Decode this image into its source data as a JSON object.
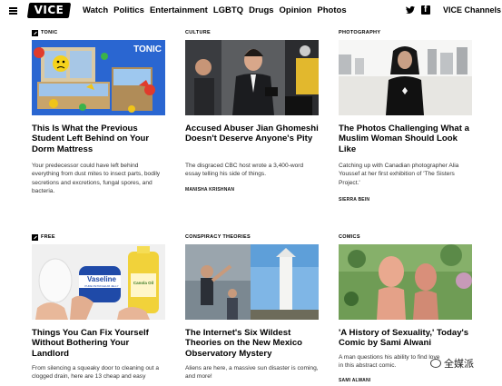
{
  "nav": {
    "logo": "VICE",
    "links": [
      "Watch",
      "Politics",
      "Entertainment",
      "LGBTQ",
      "Drugs",
      "Opinion",
      "Photos"
    ],
    "channels_label": "VICE Channels",
    "facebook_glyph": "f"
  },
  "cards": [
    {
      "category": "TONIC",
      "image_label": "TONIC",
      "headline": "This Is What the Previous Student Left Behind on Your Dorm Mattress",
      "dek": "Your predecessor could have left behind everything from dust mites to insect parts, bodily secretions and excretions, fungal spores, and bacteria.",
      "byline": ""
    },
    {
      "category": "CULTURE",
      "headline": "Accused Abuser Jian Ghomeshi Doesn't Deserve Anyone's Pity",
      "dek": "The disgraced CBC host wrote a 3,400-word essay telling his side of things.",
      "byline": "MANISHA KRISHNAN"
    },
    {
      "category": "PHOTOGRAPHY",
      "headline": "The Photos Challenging What a Muslim Woman Should Look Like",
      "dek": "Catching up with Canadian photographer Alia Youssef at her first exhibition of 'The Sisters Project.'",
      "byline": "SIERRA BEIN"
    },
    {
      "category": "FREE",
      "headline": "Things You Can Fix Yourself Without Bothering Your Landlord",
      "dek": "From silencing a squeaky door to cleaning out a clogged drain, here are 13 cheap and easy",
      "byline": ""
    },
    {
      "category": "CONSPIRACY THEORIES",
      "headline": "The Internet's Six Wildest Theories on the New Mexico Observatory Mystery",
      "dek": "Aliens are here, a massive sun disaster is coming, and more!",
      "byline": ""
    },
    {
      "category": "COMICS",
      "headline": "'A History of Sexuality,' Today's Comic by Sami Alwani",
      "dek": "A man questions his ability to find love in this abstract comic.",
      "byline": "SAMI ALWANI"
    }
  ],
  "product_labels": {
    "vaseline": "Vaseline",
    "vaseline_sub": "PURE PETROLEUM JELLY",
    "canola": "Canola Oil"
  },
  "watermark": "全媒派"
}
